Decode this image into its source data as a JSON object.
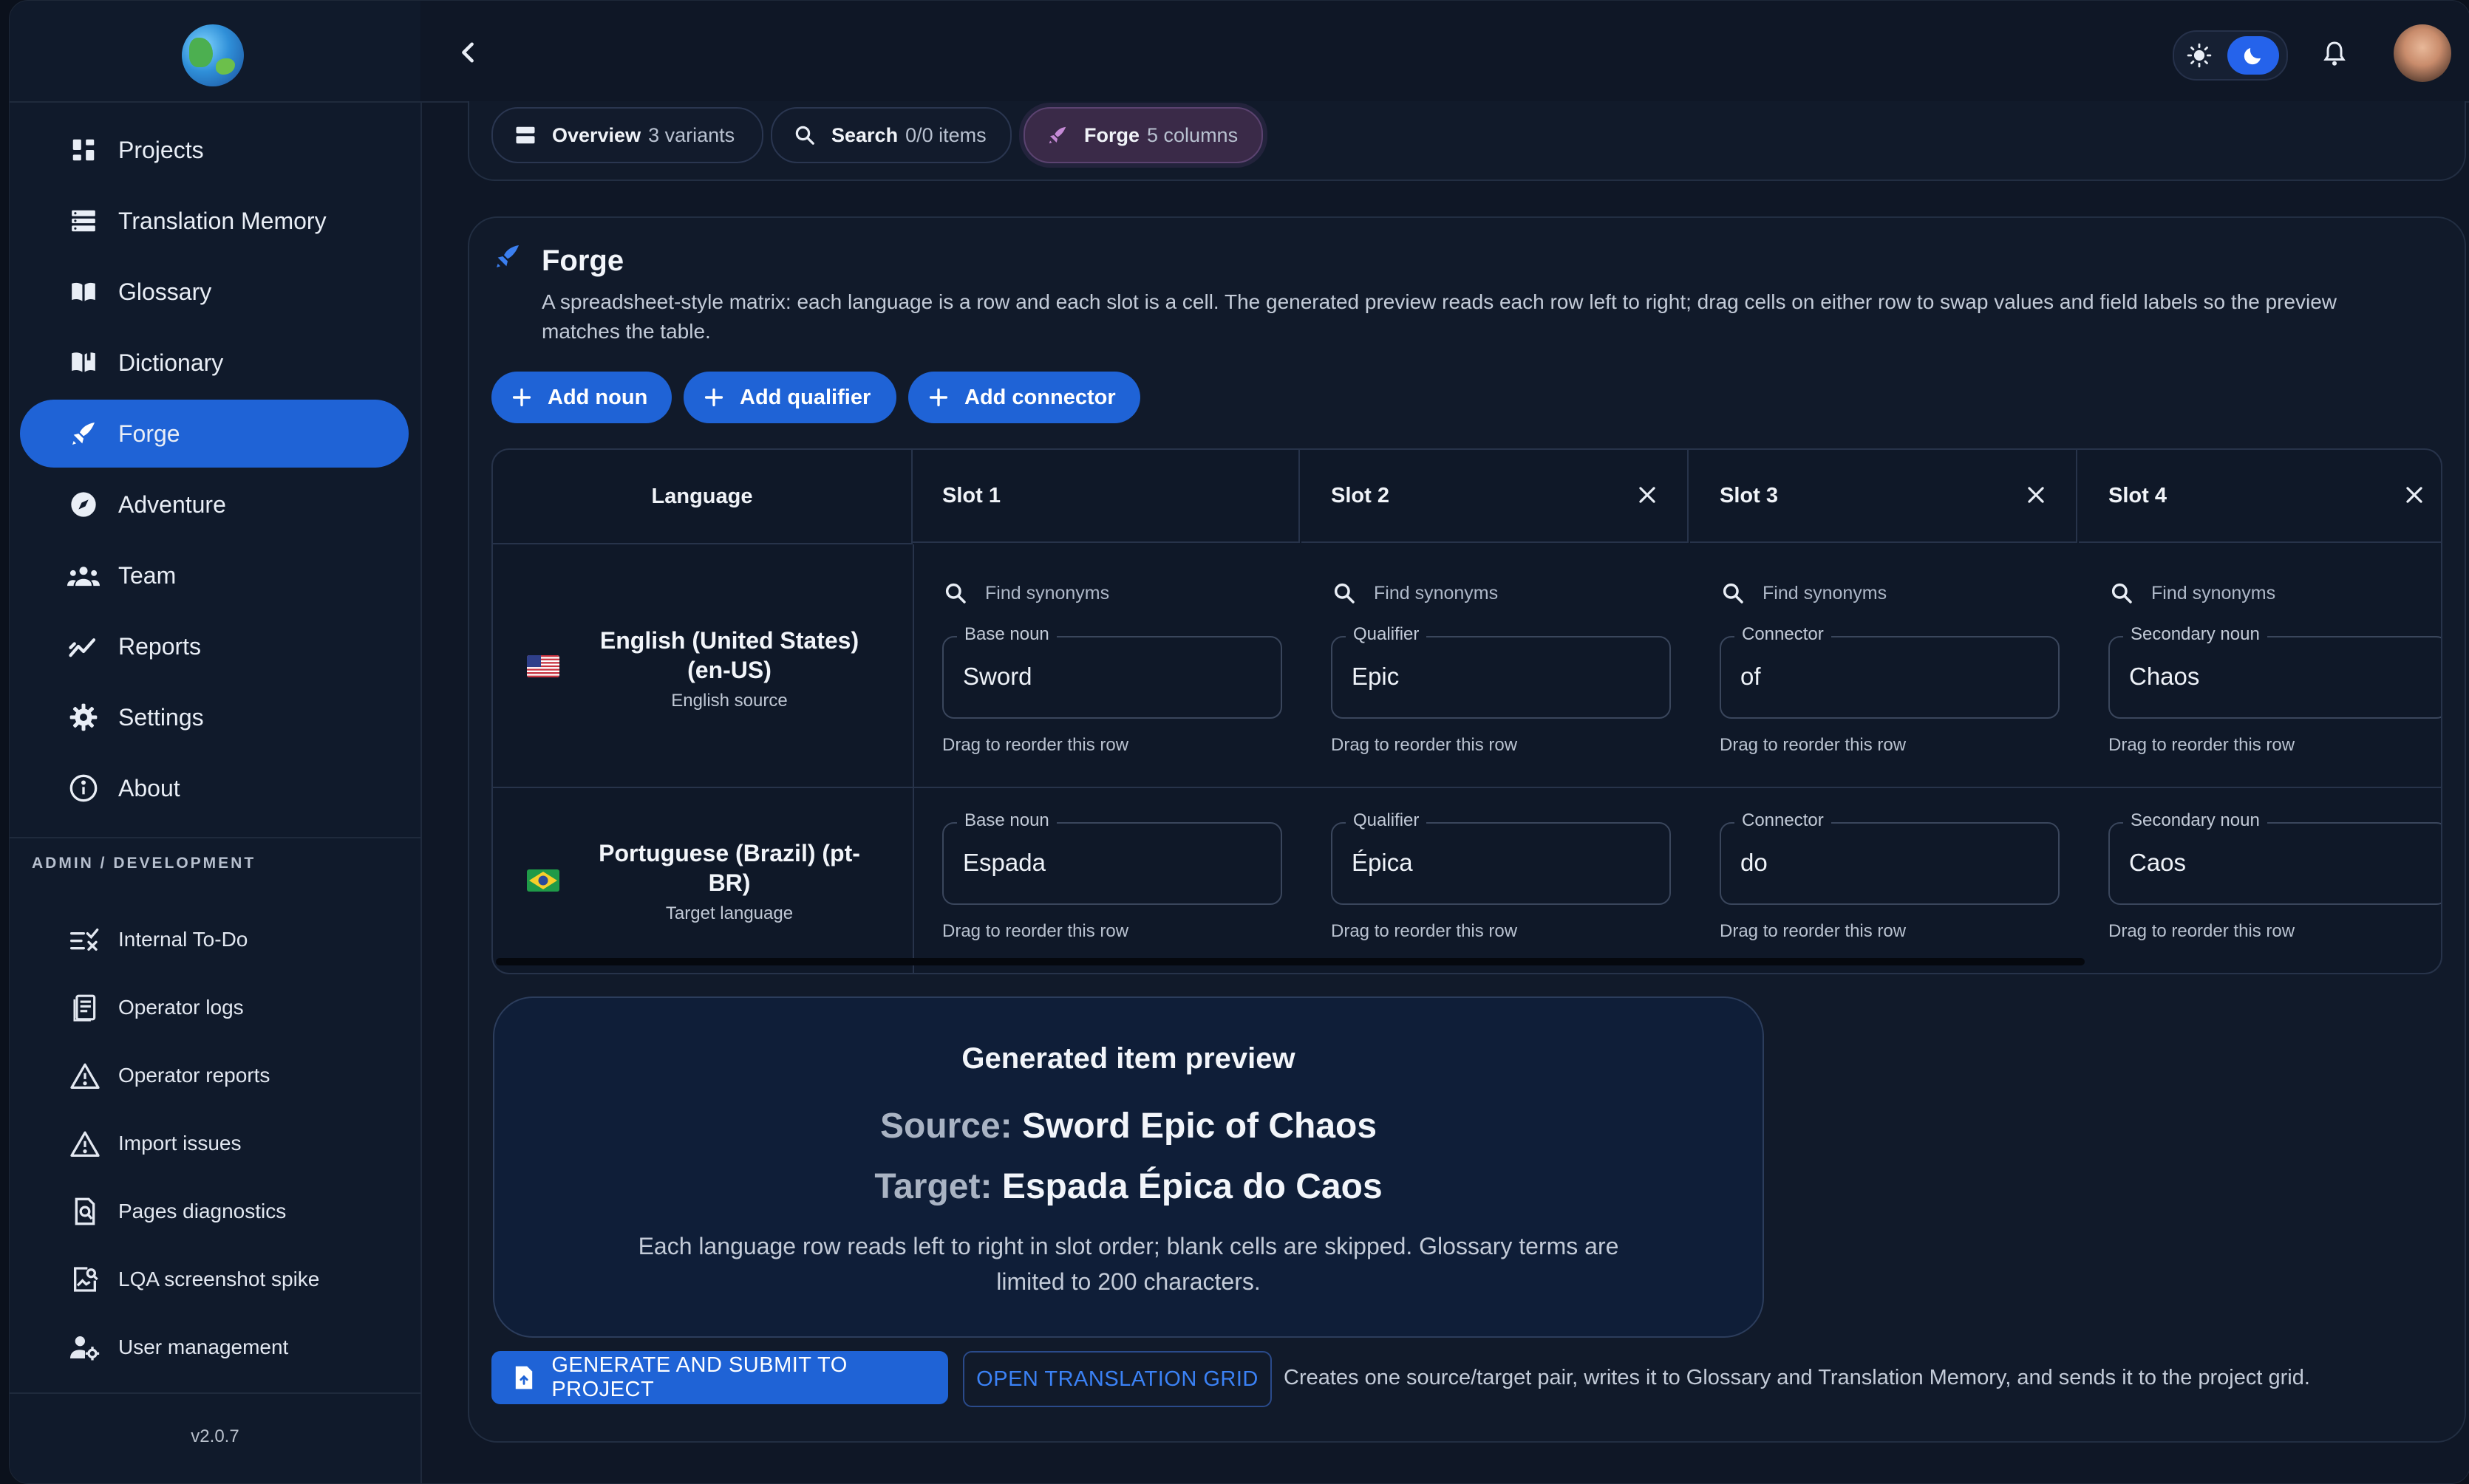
{
  "sidebar": {
    "nav": [
      {
        "label": "Projects",
        "icon": "projects-icon"
      },
      {
        "label": "Translation Memory",
        "icon": "translation-memory-icon"
      },
      {
        "label": "Glossary",
        "icon": "glossary-icon"
      },
      {
        "label": "Dictionary",
        "icon": "dictionary-icon"
      },
      {
        "label": "Forge",
        "icon": "forge-icon",
        "active": true
      },
      {
        "label": "Adventure",
        "icon": "compass-icon"
      },
      {
        "label": "Team",
        "icon": "team-icon"
      },
      {
        "label": "Reports",
        "icon": "reports-icon"
      },
      {
        "label": "Settings",
        "icon": "gear-icon"
      },
      {
        "label": "About",
        "icon": "info-icon"
      }
    ],
    "section_label": "ADMIN / DEVELOPMENT",
    "admin": [
      {
        "label": "Internal To-Do",
        "icon": "todo-icon"
      },
      {
        "label": "Operator logs",
        "icon": "logs-icon"
      },
      {
        "label": "Operator reports",
        "icon": "warning-icon"
      },
      {
        "label": "Import issues",
        "icon": "warning-icon"
      },
      {
        "label": "Pages diagnostics",
        "icon": "diagnostics-icon"
      },
      {
        "label": "LQA screenshot spike",
        "icon": "screenshot-icon"
      },
      {
        "label": "User management",
        "icon": "user-management-icon"
      }
    ],
    "version": "v2.0.7"
  },
  "tabs": [
    {
      "name": "Overview",
      "meta": "3 variants",
      "icon": "overview-icon"
    },
    {
      "name": "Search",
      "meta": "0/0 items",
      "icon": "search-icon"
    },
    {
      "name": "Forge",
      "meta": "5 columns",
      "icon": "forge-icon",
      "active": true
    }
  ],
  "forge": {
    "title": "Forge",
    "description": "A spreadsheet-style matrix: each language is a row and each slot is a cell. The generated preview reads each row left to right; drag cells on either row to swap values and field labels so the preview matches the table.",
    "add_buttons": [
      "Add noun",
      "Add qualifier",
      "Add connector"
    ],
    "table": {
      "headers": [
        "Language",
        "Slot 1",
        "Slot 2",
        "Slot 3",
        "Slot 4"
      ],
      "find_placeholder": "Find synonyms",
      "drag_hint": "Drag to reorder this row",
      "rows": [
        {
          "language": "English (United States) (en-US)",
          "role": "English source",
          "flag": "us",
          "cells": [
            {
              "label": "Base noun",
              "value": "Sword"
            },
            {
              "label": "Qualifier",
              "value": "Epic"
            },
            {
              "label": "Connector",
              "value": "of"
            },
            {
              "label": "Secondary noun",
              "value": "Chaos"
            }
          ]
        },
        {
          "language": "Portuguese (Brazil) (pt-BR)",
          "role": "Target language",
          "flag": "br",
          "cells": [
            {
              "label": "Base noun",
              "value": "Espada"
            },
            {
              "label": "Qualifier",
              "value": "Épica"
            },
            {
              "label": "Connector",
              "value": "do"
            },
            {
              "label": "Secondary noun",
              "value": "Caos"
            }
          ]
        }
      ]
    }
  },
  "preview": {
    "title": "Generated item preview",
    "source_label": "Source:",
    "source_value": "Sword Epic of Chaos",
    "target_label": "Target:",
    "target_value": "Espada Épica do Caos",
    "note": "Each language row reads left to right in slot order; blank cells are skipped. Glossary terms are limited to 200 characters."
  },
  "actions": {
    "generate": "GENERATE AND SUBMIT TO PROJECT",
    "open_grid": "OPEN TRANSLATION GRID",
    "note": "Creates one source/target pair, writes it to Glossary and Translation Memory, and sends it to the project grid."
  },
  "colors": {
    "accent": "#1f63d6",
    "background": "#0f1726",
    "card": "#111a2a"
  }
}
